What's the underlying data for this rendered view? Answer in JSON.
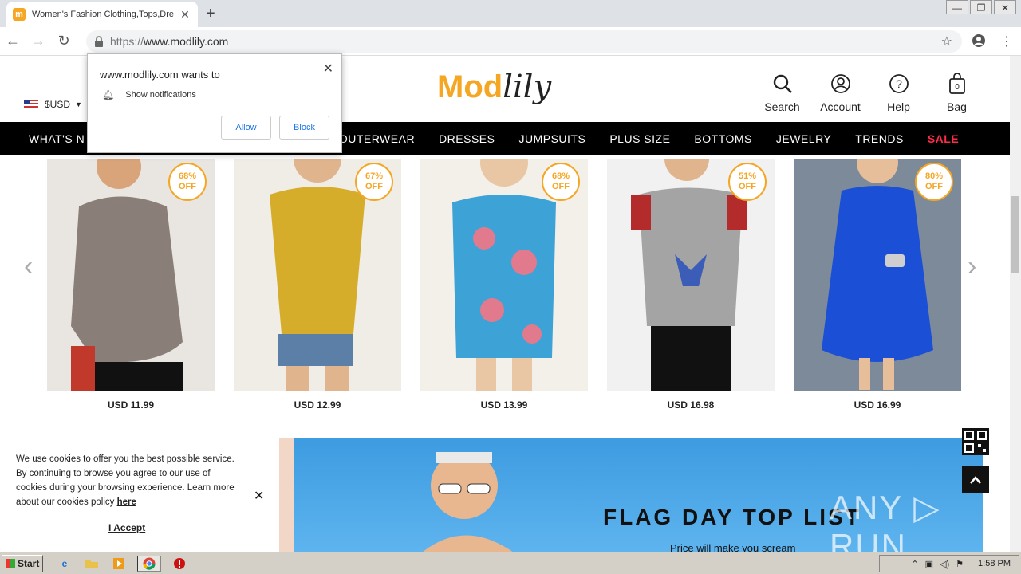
{
  "browser": {
    "tab_title": "Women's Fashion Clothing,Tops,Dre",
    "favicon_letter": "m",
    "url_scheme": "https://",
    "url_host": "www.modlily.com",
    "new_tab": "+",
    "close_tab": "✕",
    "win_min": "—",
    "win_max": "❐",
    "win_close": "✕"
  },
  "site": {
    "currency": "$USD",
    "logo_mod": "Mod",
    "logo_lily": "lily",
    "header_icons": [
      {
        "label": "Search",
        "icon": "search-icon"
      },
      {
        "label": "Account",
        "icon": "account-icon"
      },
      {
        "label": "Help",
        "icon": "help-icon"
      },
      {
        "label": "Bag",
        "icon": "bag-icon",
        "count": "0"
      }
    ],
    "nav": [
      "WHAT'S N",
      "",
      "R",
      "OUTERWEAR",
      "DRESSES",
      "JUMPSUITS",
      "PLUS SIZE",
      "BOTTOMS",
      "JEWELRY",
      "TRENDS",
      "SALE"
    ],
    "accent_color": "#f5a623",
    "sale_color": "#ff2b4a"
  },
  "products": [
    {
      "discount": "68%",
      "off": "OFF",
      "price": "USD 11.99",
      "bg": "#e9e6e2",
      "garment": "#8a7f78"
    },
    {
      "discount": "67%",
      "off": "OFF",
      "price": "USD 12.99",
      "bg": "#f0ece6",
      "garment": "#d6ad2a"
    },
    {
      "discount": "68%",
      "off": "OFF",
      "price": "USD 13.99",
      "bg": "#f3efe9",
      "garment": "#3da2d6"
    },
    {
      "discount": "51%",
      "off": "OFF",
      "price": "USD 16.98",
      "bg": "#f1f1f1",
      "garment": "#a4a4a4"
    },
    {
      "discount": "80%",
      "off": "OFF",
      "price": "USD 16.99",
      "bg": "#7d8a9a",
      "garment": "#1b4fd6"
    }
  ],
  "banner": {
    "title": "FLAG DAY TOP LIST",
    "subtitle": "Price will make you scream"
  },
  "notification": {
    "title": "www.modlily.com wants to",
    "permission": "Show notifications",
    "allow": "Allow",
    "block": "Block",
    "close": "✕"
  },
  "cookie": {
    "text": "We use cookies to offer you the best possible service. By continuing to browse you agree to our use of cookies during your browsing experience. Learn more about our cookies policy ",
    "link": "here",
    "accept": "I Accept",
    "close": "✕"
  },
  "watermark": "ANY ▷ RUN",
  "taskbar": {
    "start": "Start",
    "time": "1:58 PM"
  }
}
